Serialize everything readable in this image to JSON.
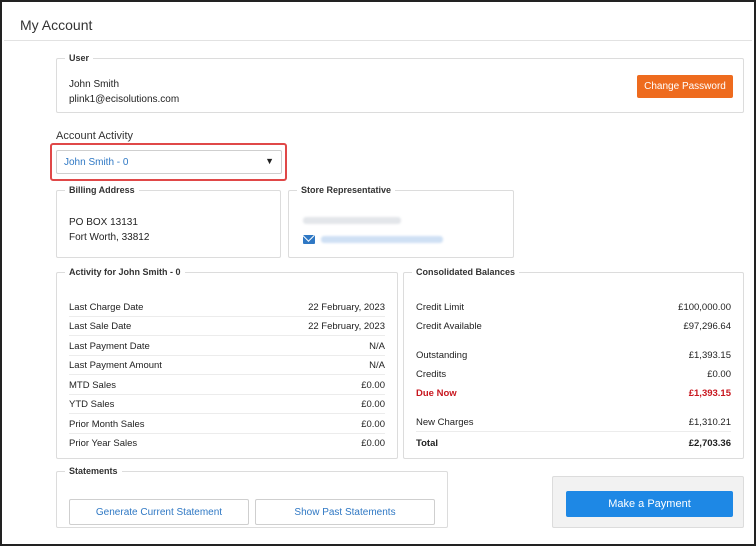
{
  "page": {
    "title": "My Account"
  },
  "user": {
    "legend": "User",
    "name": "John Smith",
    "email": "plink1@ecisolutions.com",
    "change_password_label": "Change Password"
  },
  "account_activity": {
    "label": "Account Activity",
    "selected_account": "John Smith - 0"
  },
  "billing": {
    "legend": "Billing Address",
    "line1": "PO BOX 13131",
    "line2": "Fort Worth, 33812"
  },
  "store_rep": {
    "legend": "Store Representative",
    "icon": "mail-icon"
  },
  "activity": {
    "legend": "Activity for John Smith - 0",
    "rows": [
      {
        "label": "Last Charge Date",
        "value": "22 February, 2023"
      },
      {
        "label": "Last Sale Date",
        "value": "22 February, 2023"
      },
      {
        "label": "Last Payment Date",
        "value": "N/A"
      },
      {
        "label": "Last Payment Amount",
        "value": "N/A"
      },
      {
        "label": "MTD Sales",
        "value": "£0.00"
      },
      {
        "label": "YTD Sales",
        "value": "£0.00"
      },
      {
        "label": "Prior Month Sales",
        "value": "£0.00"
      },
      {
        "label": "Prior Year Sales",
        "value": "£0.00"
      }
    ]
  },
  "balances": {
    "legend": "Consolidated Balances",
    "rows": [
      {
        "label": "Credit Limit",
        "value": "£100,000.00"
      },
      {
        "label": "Credit Available",
        "value": "£97,296.64"
      },
      {
        "label": "Outstanding",
        "value": "£1,393.15"
      },
      {
        "label": "Credits",
        "value": "£0.00"
      },
      {
        "label": "Due Now",
        "value": "£1,393.15"
      },
      {
        "label": "New Charges",
        "value": "£1,310.21"
      },
      {
        "label": "Total",
        "value": "£2,703.36"
      }
    ]
  },
  "statements": {
    "legend": "Statements",
    "generate_label": "Generate Current Statement",
    "past_label": "Show Past Statements"
  },
  "payment": {
    "make_payment_label": "Make a Payment"
  },
  "colors": {
    "accent_orange": "#ee6b1e",
    "link_blue": "#2f78c4",
    "primary_blue": "#1e88e5",
    "due_red": "#c8171f",
    "highlight_red": "#e04848"
  }
}
